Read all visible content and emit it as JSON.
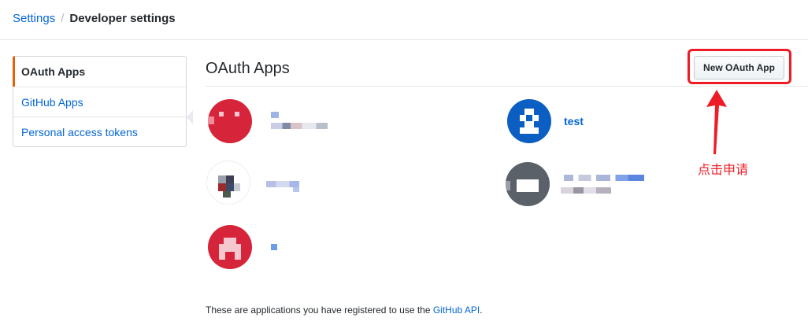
{
  "breadcrumb": {
    "parent": "Settings",
    "separator": "/",
    "current": "Developer settings"
  },
  "sidebar": {
    "items": [
      {
        "label": "OAuth Apps",
        "selected": true
      },
      {
        "label": "GitHub Apps",
        "selected": false
      },
      {
        "label": "Personal access tokens",
        "selected": false
      }
    ]
  },
  "main": {
    "title": "OAuth Apps",
    "new_button_label": "New OAuth App",
    "apps": [
      {
        "name": "",
        "avatar_color": "#d6243a",
        "name_pixelated": true
      },
      {
        "name": "test",
        "avatar_color": "#0b5fc2",
        "name_pixelated": false
      },
      {
        "name": "",
        "avatar_color": "#ffffff",
        "name_pixelated": true
      },
      {
        "name": "",
        "avatar_color": "#5a6168",
        "name_pixelated": true
      },
      {
        "name": "",
        "avatar_color": "#d6243a",
        "name_pixelated": true
      }
    ],
    "footer_text": "These are applications you have registered to use the ",
    "footer_link": "GitHub API",
    "footer_end": "."
  },
  "annotation": {
    "text": "点击申请",
    "color": "#ee1c25"
  }
}
